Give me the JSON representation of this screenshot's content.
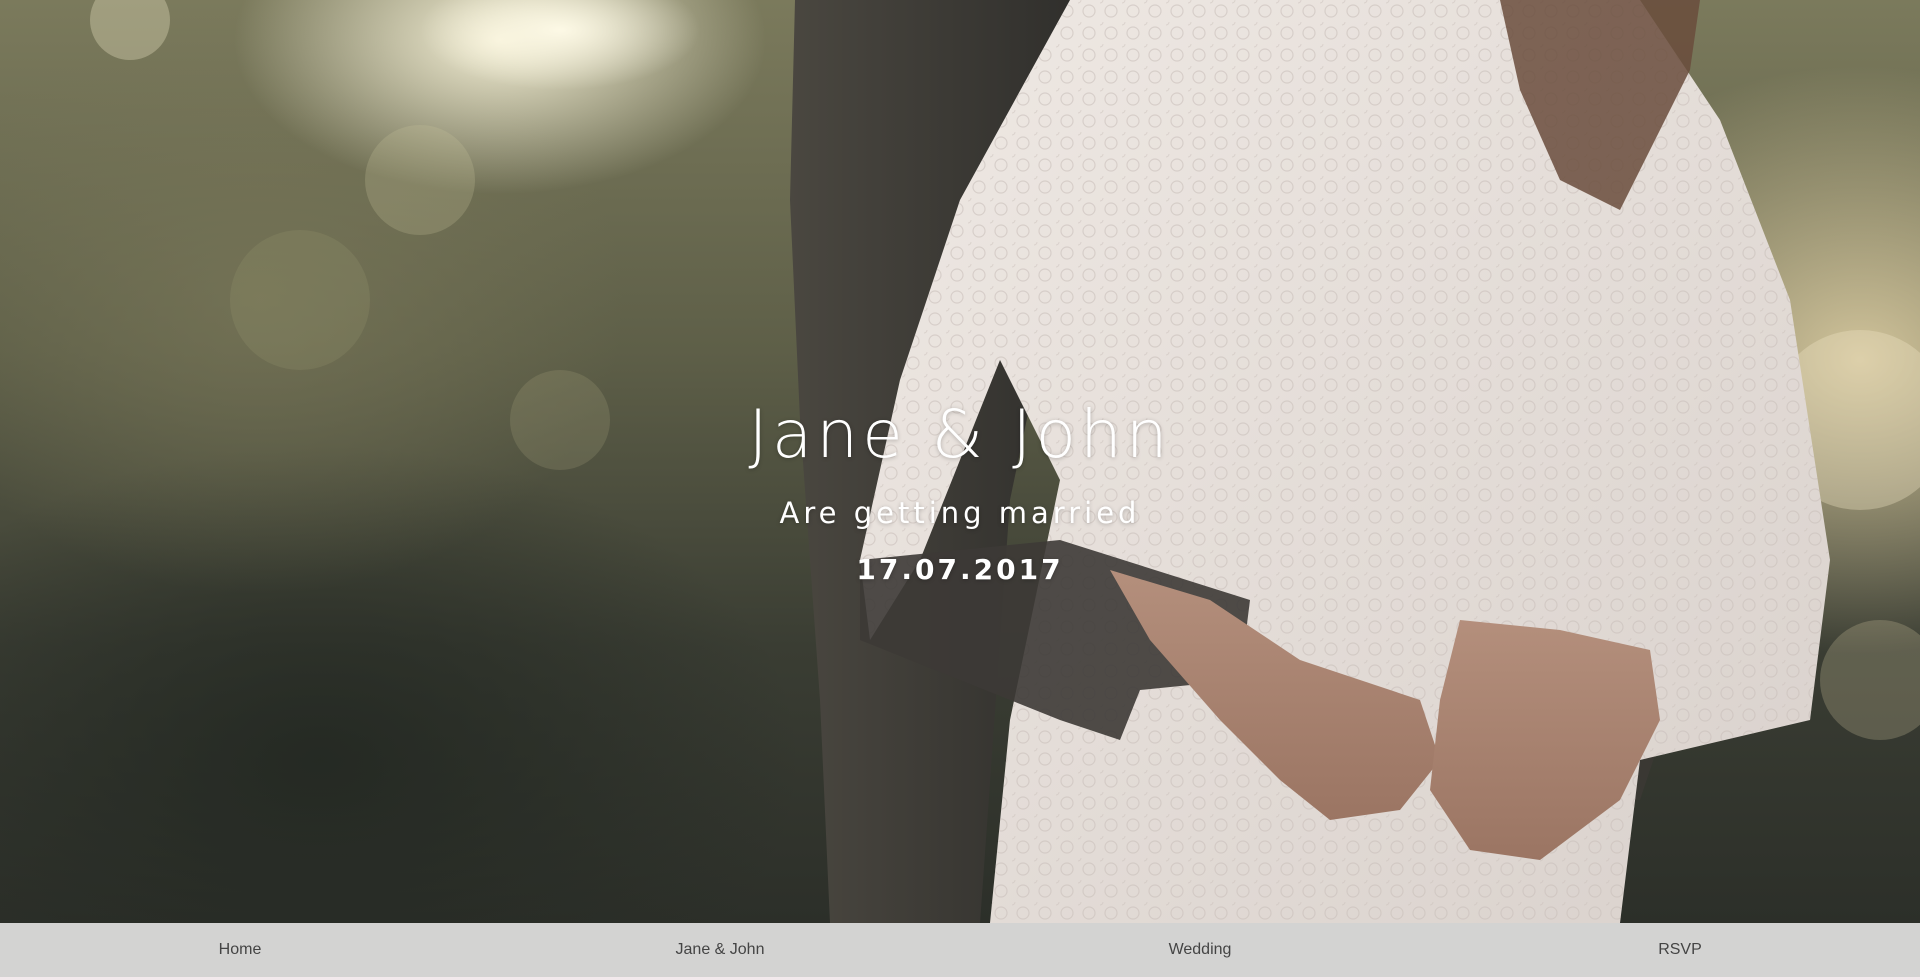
{
  "hero": {
    "couple_names": "Jane & John",
    "tagline": "Are getting married",
    "date": "17.07.2017"
  },
  "nav": {
    "items": [
      {
        "label": "Home"
      },
      {
        "label": "Jane & John"
      },
      {
        "label": "Wedding"
      },
      {
        "label": "RSVP"
      }
    ]
  },
  "colors": {
    "nav_background": "#ebebeb",
    "nav_text": "#444444",
    "hero_text": "#ffffff",
    "dress": "#e9e2de",
    "suit": "#3b3a36"
  }
}
